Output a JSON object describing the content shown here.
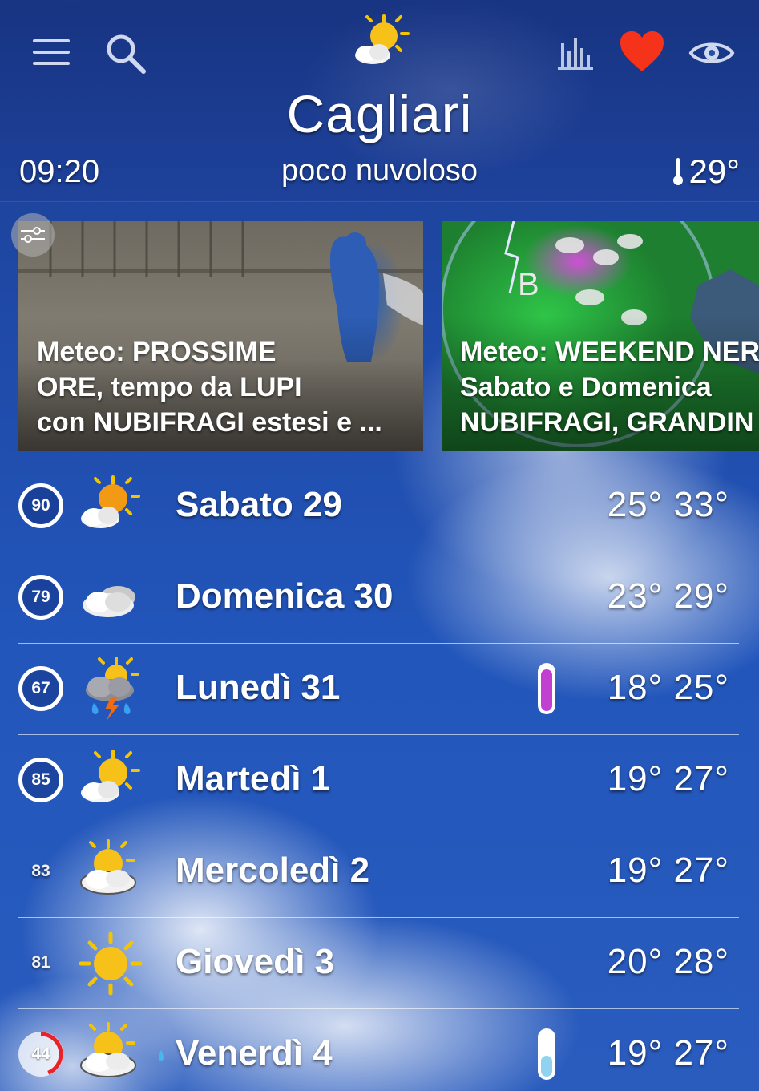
{
  "header": {
    "city": "Cagliari",
    "time": "09:20",
    "condition": "poco nuvoloso",
    "current_temp": "29°"
  },
  "news": [
    {
      "caption_lines": [
        "Meteo: PROSSIME",
        "ORE, tempo da LUPI",
        "con NUBIFRAGI estesi e ..."
      ]
    },
    {
      "caption_lines": [
        "Meteo: WEEKEND NER",
        "Sabato e Domenica",
        "NUBIFRAGI, GRANDIN"
      ]
    }
  ],
  "forecast": [
    {
      "score": "90",
      "score_fraction": 0.9,
      "icon": "sun-cloud-icon",
      "day": "Sabato 29",
      "range": "25° 33°",
      "thermometer": false,
      "rain_drop": false,
      "ring": true
    },
    {
      "score": "79",
      "score_fraction": 0.79,
      "icon": "cloud-icon",
      "day": "Domenica 30",
      "range": "23° 29°",
      "thermometer": false,
      "rain_drop": false,
      "ring": true
    },
    {
      "score": "67",
      "score_fraction": 0.67,
      "icon": "thunderstorm-icon",
      "day": "Lunedì 31",
      "range": "18° 25°",
      "thermometer": true,
      "thermometer_color": "#c13fd1",
      "thermometer_level": 0.85,
      "rain_drop": false,
      "ring": true
    },
    {
      "score": "85",
      "score_fraction": 0.85,
      "icon": "sun-cloud-icon",
      "day": "Martedì 1",
      "range": "19° 27°",
      "thermometer": false,
      "rain_drop": false,
      "ring": true
    },
    {
      "score": "83",
      "score_fraction": 0.83,
      "icon": "sun-cloud-icon",
      "day": "Mercoledì 2",
      "range": "19° 27°",
      "thermometer": false,
      "rain_drop": false,
      "ring": false
    },
    {
      "score": "81",
      "score_fraction": 0.81,
      "icon": "sun-icon",
      "day": "Giovedì 3",
      "range": "20° 28°",
      "thermometer": false,
      "rain_drop": false,
      "ring": false
    },
    {
      "score": "44",
      "score_fraction": 0.44,
      "icon": "sun-cloud-icon",
      "day": "Venerdì 4",
      "range": "19° 27°",
      "thermometer": true,
      "thermometer_color": "#8fd3f0",
      "thermometer_level": 0.4,
      "rain_drop": true,
      "ring": true,
      "ring_color": "#e8242a"
    }
  ],
  "colors": {
    "heart": "#f5321a",
    "ring_default": "#ffffff"
  }
}
